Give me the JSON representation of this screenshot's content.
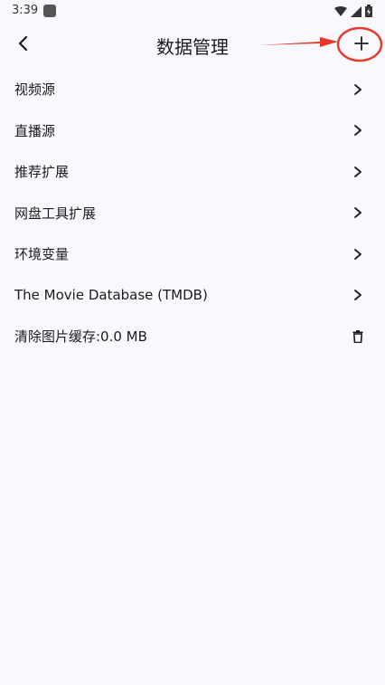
{
  "status_bar": {
    "time": "3:39",
    "icons": [
      "wifi-icon",
      "signal-icon",
      "battery-charging-icon"
    ]
  },
  "app_bar": {
    "title": "数据管理",
    "back_icon": "chevron-left-icon",
    "action_icon": "plus-icon"
  },
  "annotation": {
    "color": "#e53a2a"
  },
  "items": [
    {
      "label": "视频源",
      "icon": "chevron-right-icon"
    },
    {
      "label": "直播源",
      "icon": "chevron-right-icon"
    },
    {
      "label": "推荐扩展",
      "icon": "chevron-right-icon"
    },
    {
      "label": "网盘工具扩展",
      "icon": "chevron-right-icon"
    },
    {
      "label": "环境变量",
      "icon": "chevron-right-icon"
    },
    {
      "label": "The Movie Database (TMDB)",
      "icon": "chevron-right-icon"
    },
    {
      "label": "清除图片缓存:0.0 MB",
      "icon": "trash-icon"
    }
  ]
}
